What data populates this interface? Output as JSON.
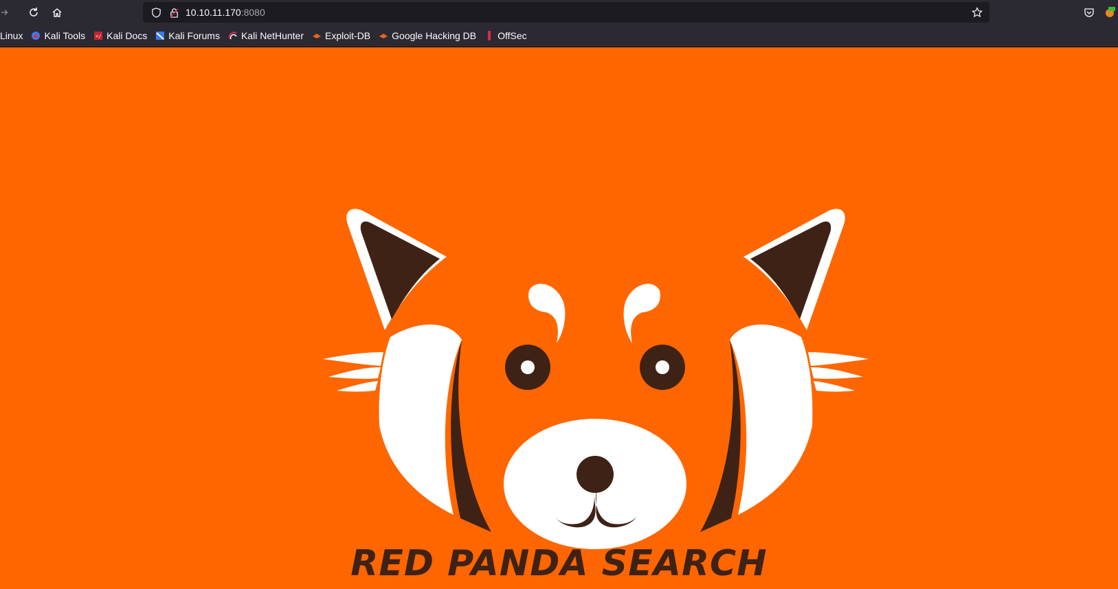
{
  "browser": {
    "url_host": "10.10.11.170",
    "url_port": ":8080",
    "bookmarks": [
      {
        "label": "Linux",
        "icon": "kali-icon"
      },
      {
        "label": "Kali Tools",
        "icon": "kali-tools-icon"
      },
      {
        "label": "Kali Docs",
        "icon": "kali-docs-icon"
      },
      {
        "label": "Kali Forums",
        "icon": "kali-forums-icon"
      },
      {
        "label": "Kali NetHunter",
        "icon": "nethunter-icon"
      },
      {
        "label": "Exploit-DB",
        "icon": "exploit-db-icon"
      },
      {
        "label": "Google Hacking DB",
        "icon": "ghdb-icon"
      },
      {
        "label": "OffSec",
        "icon": "offsec-icon"
      }
    ]
  },
  "page": {
    "title": "RED PANDA SEARCH",
    "background": "#ff6600",
    "accent_dark": "#3f2216"
  }
}
